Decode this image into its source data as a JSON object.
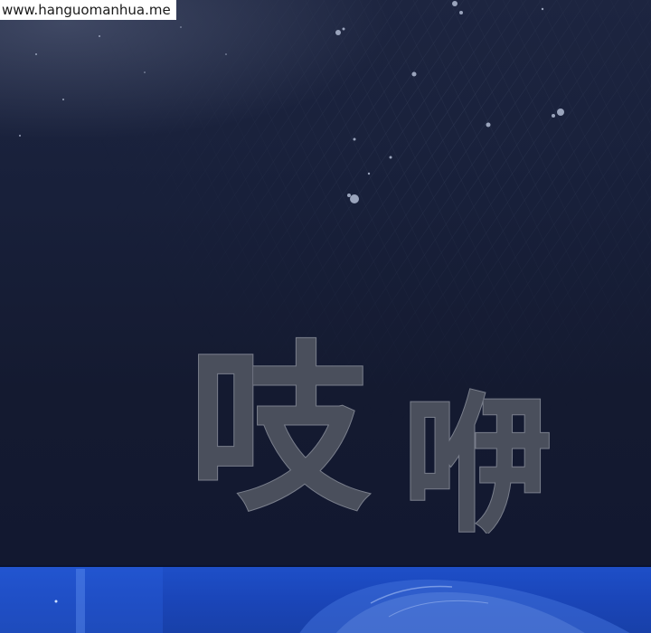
{
  "watermark": {
    "text": "www.hanguomanhua.me"
  },
  "sound_effect": {
    "chars": [
      "吱",
      "咿"
    ]
  },
  "colors": {
    "sky": "#141a30",
    "sfx_fill": "#4a4f5c",
    "sfx_outline": "#7a7f8c",
    "panel_blue": "#1e4fc8"
  }
}
